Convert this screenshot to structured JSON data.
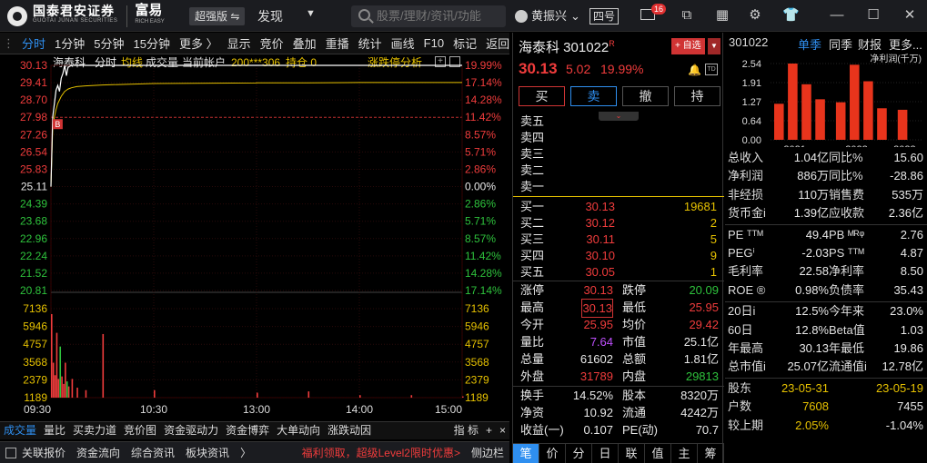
{
  "app": {
    "logo_cn": "国泰君安证券",
    "logo_en": "GUOTAI JUNAN SECURITIES",
    "product": "富易",
    "product_en": "RICH EASY",
    "edition": "超强版 ⇋",
    "discover": "发现",
    "search_placeholder": "股票/理财/资讯/功能",
    "user": "黄振兴",
    "user_caret": "⌄",
    "sihao": "四号",
    "mail_badge": "16"
  },
  "toolbar": {
    "items": [
      "分时",
      "1分钟",
      "5分钟",
      "15分钟",
      "更多 〉"
    ],
    "right_items": [
      "显示",
      "竞价",
      "叠加",
      "重播",
      "统计",
      "画线",
      "F10",
      "标记",
      "返回"
    ],
    "active": "分时"
  },
  "chart_info": {
    "name": "海泰科",
    "mode": "分时",
    "avg_label": "均线",
    "vol_label": "成交量",
    "account": "当前帐户",
    "account_no": "200***306",
    "position": "持仓 0",
    "analysis": "涨跌停分析"
  },
  "price_axis": {
    "left": [
      "30.13",
      "29.41",
      "28.70",
      "27.98",
      "27.26",
      "26.54",
      "25.83",
      "25.11",
      "24.39",
      "23.68",
      "22.96",
      "22.24",
      "21.52",
      "20.81"
    ],
    "right": [
      "19.99%",
      "17.14%",
      "14.28%",
      "11.42%",
      "8.57%",
      "5.71%",
      "2.86%",
      "0.00%",
      "2.86%",
      "5.71%",
      "8.57%",
      "11.42%",
      "14.28%",
      "17.14%"
    ]
  },
  "volume_axis": [
    "7136",
    "5946",
    "4757",
    "3568",
    "2379",
    "1189"
  ],
  "time_axis": [
    "09:30",
    "10:30",
    "13:00",
    "14:00",
    "15:00"
  ],
  "markers": {
    "buy": "B"
  },
  "chart_data": {
    "type": "line",
    "title": "",
    "xlabel": "",
    "ylabel": "",
    "x": [
      "09:30",
      "09:31",
      "09:32",
      "09:33",
      "09:34",
      "09:35",
      "09:36",
      "09:37",
      "09:38",
      "09:39",
      "09:40",
      "09:42",
      "09:45",
      "09:50",
      "10:00",
      "10:30",
      "11:30",
      "13:00",
      "13:30",
      "14:00",
      "14:30",
      "15:00"
    ],
    "series": [
      {
        "values": [
          25.11,
          27.98,
          28.55,
          29.1,
          29.3,
          29.05,
          29.6,
          29.8,
          30.13,
          29.7,
          30.05,
          30.13,
          30.13,
          30.13,
          30.13,
          30.13,
          30.13,
          30.13,
          30.13,
          30.13,
          30.13,
          30.13
        ]
      },
      {
        "values": [
          25.11,
          27.5,
          28.0,
          28.3,
          28.55,
          28.7,
          28.85,
          28.95,
          29.05,
          29.1,
          29.15,
          29.2,
          29.25,
          29.28,
          29.32,
          29.38,
          29.4,
          29.41,
          29.41,
          29.42,
          29.42,
          29.42
        ]
      }
    ],
    "volume": [
      6700,
      2800,
      1800,
      5200,
      1500,
      4100,
      1700,
      1100,
      2800,
      1300,
      900,
      1500,
      800,
      600,
      5100,
      600,
      400,
      300,
      500,
      200,
      200,
      100
    ],
    "ylim": [
      20.81,
      30.13
    ],
    "volume_ylim": [
      0,
      7136
    ]
  },
  "bottom_tabs": [
    "成交量",
    "量比",
    "买卖力道",
    "竞价图",
    "资金驱动力",
    "资金博弈",
    "大单动向",
    "涨跌动因",
    "指 标",
    "+",
    "×"
  ],
  "bottom_bar": {
    "items": [
      "关联报价",
      "资金流向",
      "综合资讯",
      "板块资讯",
      "〉"
    ],
    "promo": "福利领取，超级Level2限时优惠>",
    "side": "侧边栏"
  },
  "quote": {
    "name": "海泰科 301022",
    "badge": "R",
    "add_btn": "+ 自选",
    "price": "30.13",
    "change": "5.02",
    "pct": "19.99%",
    "actions": [
      "买",
      "卖",
      "撤",
      "持"
    ],
    "asks": [
      {
        "label": "卖五",
        "price": "",
        "vol": ""
      },
      {
        "label": "卖四",
        "price": "",
        "vol": ""
      },
      {
        "label": "卖三",
        "price": "",
        "vol": ""
      },
      {
        "label": "卖二",
        "price": "",
        "vol": ""
      },
      {
        "label": "卖一",
        "price": "",
        "vol": ""
      }
    ],
    "bids": [
      {
        "label": "买一",
        "price": "30.13",
        "vol": "19681"
      },
      {
        "label": "买二",
        "price": "30.12",
        "vol": "2"
      },
      {
        "label": "买三",
        "price": "30.11",
        "vol": "5"
      },
      {
        "label": "买四",
        "price": "30.10",
        "vol": "9"
      },
      {
        "label": "买五",
        "price": "30.05",
        "vol": "1"
      }
    ],
    "stats1": [
      {
        "k1": "涨停",
        "v1": "30.13",
        "k2": "跌停",
        "v2": "20.09"
      },
      {
        "k1": "最高",
        "v1": "30.13",
        "k2": "最低",
        "v2": "25.95"
      },
      {
        "k1": "今开",
        "v1": "25.95",
        "k2": "均价",
        "v2": "29.42"
      },
      {
        "k1": "量比",
        "v1": "7.64",
        "k2": "市值",
        "v2": "25.1亿"
      },
      {
        "k1": "总量",
        "v1": "61602",
        "k2": "总额",
        "v2": "1.81亿"
      },
      {
        "k1": "外盘",
        "v1": "31789",
        "k2": "内盘",
        "v2": "29813"
      }
    ],
    "stats2": [
      {
        "k1": "换手",
        "v1": "14.52%",
        "k2": "股本",
        "v2": "8320万"
      },
      {
        "k1": "净资",
        "v1": "10.92",
        "k2": "流通",
        "v2": "4242万"
      },
      {
        "k1": "收益(一)",
        "v1": "0.107",
        "k2": "PE(动)",
        "v2": "70.7"
      }
    ],
    "tabs": [
      "笔",
      "价",
      "分",
      "日",
      "联",
      "值",
      "主",
      "筹"
    ]
  },
  "fund": {
    "code": "301022",
    "tabs": [
      "单季",
      "同季",
      "财报",
      "更多..."
    ],
    "legend": "净利润(千万)",
    "y_ticks": [
      "2.54",
      "1.91",
      "1.27",
      "0.64",
      "0.00"
    ],
    "x_ticks": [
      "2021",
      "2022",
      "2023"
    ],
    "chart_data": {
      "type": "bar",
      "title": "",
      "ylabel": "净利润(千万)",
      "categories": [
        "2021Q1",
        "2021Q2",
        "2021Q3",
        "2021Q4",
        "2022Q1",
        "2022Q2",
        "2022Q3",
        "2022Q4",
        "2023Q1"
      ],
      "values": [
        1.2,
        2.54,
        1.85,
        1.35,
        1.25,
        2.5,
        1.95,
        1.05,
        1.0
      ],
      "ylim": [
        0,
        2.54
      ]
    },
    "rows": [
      {
        "k1": "总收入",
        "v1": "1.04亿",
        "k2": "同比%",
        "v2": "15.60"
      },
      {
        "k1": "净利润",
        "v1": "886万",
        "k2": "同比%",
        "v2": "-28.86"
      },
      {
        "k1": "非经损",
        "v1": "110万",
        "k2": "销售费",
        "v2": "535万"
      },
      {
        "k1": "货币金i",
        "v1": "1.39亿",
        "k2": "应收款",
        "v2": "2.36亿"
      },
      {
        "k1": "PE ᵀᵀᴹ",
        "v1": "49.4",
        "k2": "PB ᴹᴿᵠ",
        "v2": "2.76"
      },
      {
        "k1": "PEGⁱ",
        "v1": "-2.03",
        "k2": "PS ᵀᵀᴹ",
        "v2": "4.87"
      },
      {
        "k1": "毛利率",
        "v1": "22.58",
        "k2": "净利率",
        "v2": "8.50"
      },
      {
        "k1": "ROE ®",
        "v1": "0.98%",
        "k2": "负债率",
        "v2": "35.43"
      },
      {
        "k1": "20日i",
        "v1": "12.5%",
        "k2": "今年来",
        "v2": "23.0%"
      },
      {
        "k1": "60日",
        "v1": "12.8%",
        "k2": "Beta值",
        "v2": "1.03"
      },
      {
        "k1": "年最高",
        "v1": "30.13",
        "k2": "年最低",
        "v2": "19.86"
      },
      {
        "k1": "总市值i",
        "v1": "25.07亿",
        "k2": "流通值i",
        "v2": "12.78亿"
      },
      {
        "k1": "股东",
        "v1": "23-05-31",
        "k2": "",
        "v2": "23-05-19"
      },
      {
        "k1": "户数",
        "v1": "7608",
        "k2": "",
        "v2": "7455"
      },
      {
        "k1": "较上期",
        "v1": "2.05%",
        "k2": "",
        "v2": "-1.04%"
      }
    ]
  },
  "colors": {
    "up": "#f03c3c",
    "down": "#2ec23c",
    "price_line": "#ffffff",
    "avg_line": "#e6c100",
    "accent": "#2f8ff0"
  }
}
